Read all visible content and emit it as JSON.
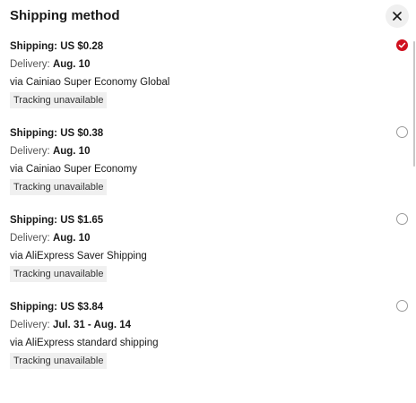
{
  "header": {
    "title": "Shipping method",
    "close_icon": "close-icon"
  },
  "options": [
    {
      "price_label": "Shipping: US $0.28",
      "delivery_prefix": "Delivery: ",
      "delivery_date": "Aug. 10",
      "carrier": "via Cainiao Super Economy Global",
      "tracking": "Tracking unavailable",
      "selected": true
    },
    {
      "price_label": "Shipping: US $0.38",
      "delivery_prefix": "Delivery: ",
      "delivery_date": "Aug. 10",
      "carrier": "via Cainiao Super Economy",
      "tracking": "Tracking unavailable",
      "selected": false
    },
    {
      "price_label": "Shipping: US $1.65",
      "delivery_prefix": "Delivery: ",
      "delivery_date": "Aug. 10",
      "carrier": "via AliExpress Saver Shipping",
      "tracking": "Tracking unavailable",
      "selected": false
    },
    {
      "price_label": "Shipping: US $3.84",
      "delivery_prefix": "Delivery: ",
      "delivery_date": "Jul. 31 - Aug. 14",
      "carrier": "via AliExpress standard shipping",
      "tracking": "Tracking unavailable",
      "selected": false
    }
  ],
  "colors": {
    "accent": "#d0101e",
    "tag_background": "#f0f0f0",
    "muted_text": "#555555"
  }
}
